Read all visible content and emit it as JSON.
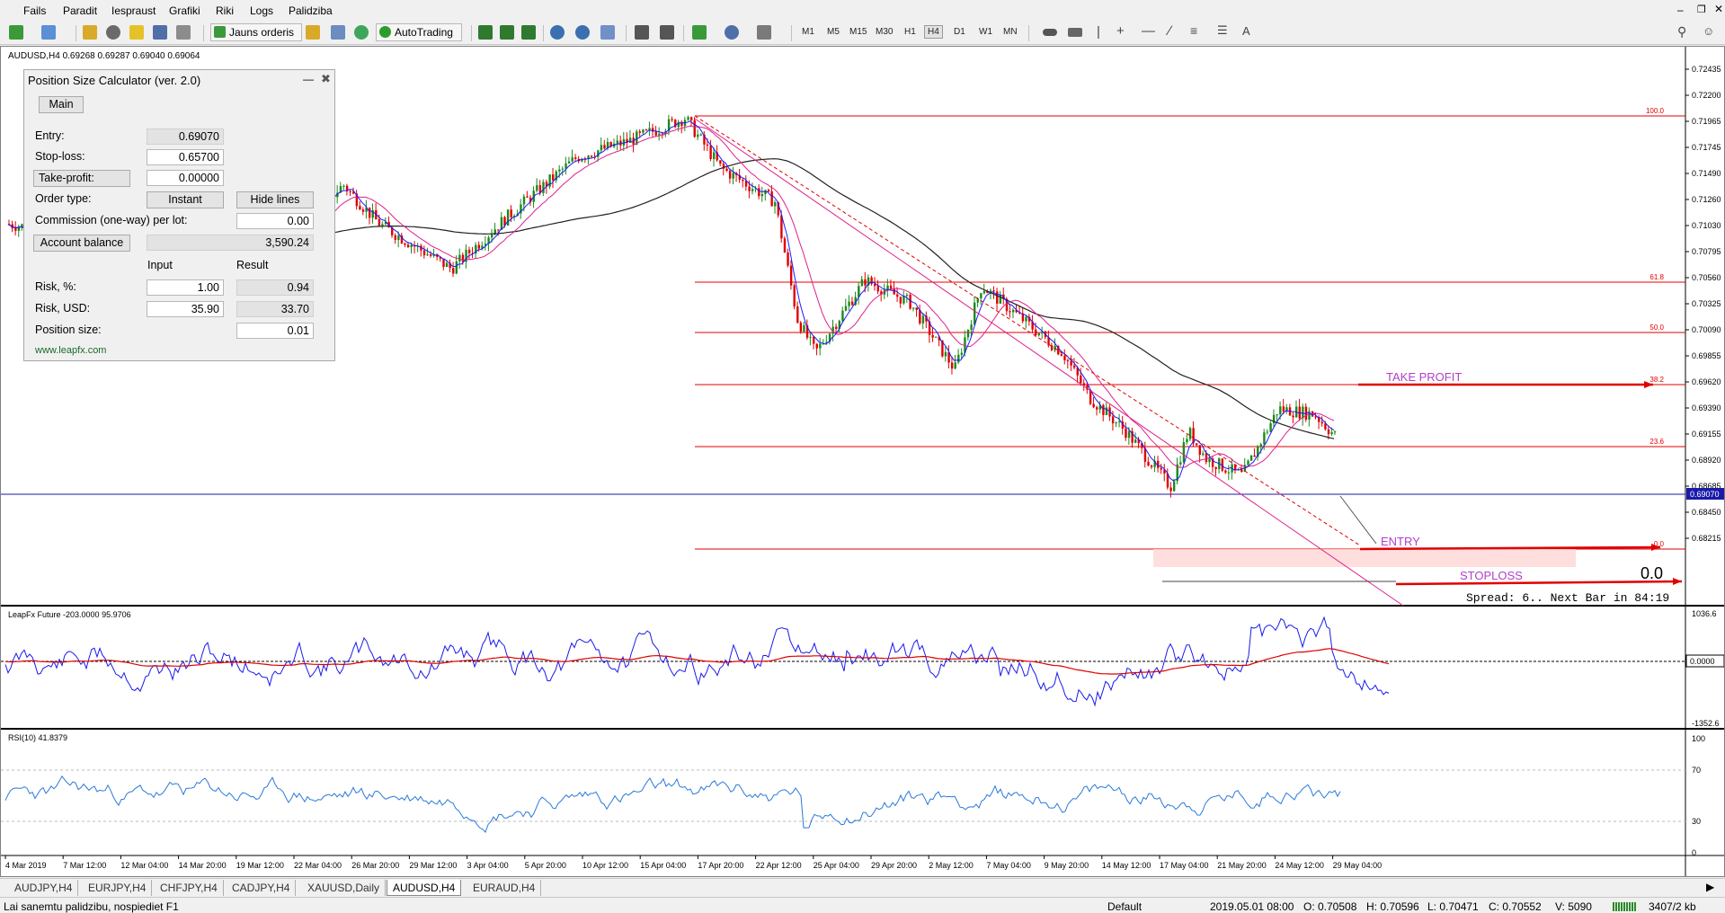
{
  "menu": [
    "Fails",
    "Paradit",
    "Iespraust",
    "Grafiki",
    "Riki",
    "Logs",
    "Palidziba"
  ],
  "toolbar": {
    "new_order_label": "Jauns orderis",
    "autotrading_label": "AutoTrading",
    "timeframes": [
      "M1",
      "M5",
      "M15",
      "M30",
      "H1",
      "H4",
      "D1",
      "W1",
      "MN"
    ],
    "active_timeframe": "H4",
    "text_tool": "A"
  },
  "chart": {
    "header": "AUDUSD,H4  0.69268 0.69287 0.69040 0.69064",
    "price_labels": [
      "0.72435",
      "0.72200",
      "0.71965",
      "0.71745",
      "0.71490",
      "0.71260",
      "0.71030",
      "0.70795",
      "0.70560",
      "0.70325",
      "0.70090",
      "0.69855",
      "0.69620",
      "0.69390",
      "0.69155",
      "0.68920",
      "0.68685",
      "0.68450",
      "0.68215"
    ],
    "current_price": "0.69070",
    "fib_levels": [
      "100.0",
      "61.8",
      "50.0",
      "38.2",
      "23.6",
      "0.0"
    ],
    "take_profit_label": "TAKE PROFIT",
    "entry_label": "ENTRY",
    "stoploss_label": "STOPLOSS",
    "big_value": "0.0",
    "spread_text": "Spread: 6.. Next Bar in 84:19",
    "time_labels": [
      "4 Mar 2019",
      "7 Mar 12:00",
      "12 Mar 04:00",
      "14 Mar 20:00",
      "19 Mar 12:00",
      "22 Mar 04:00",
      "26 Mar 20:00",
      "29 Mar 12:00",
      "3 Apr 04:00",
      "5 Apr 20:00",
      "10 Apr 12:00",
      "15 Apr 04:00",
      "17 Apr 20:00",
      "22 Apr 12:00",
      "25 Apr 04:00",
      "29 Apr 20:00",
      "2 May 12:00",
      "7 May 04:00",
      "9 May 20:00",
      "14 May 12:00",
      "17 May 04:00",
      "21 May 20:00",
      "24 May 12:00",
      "29 May 04:00"
    ],
    "indicator1": {
      "label": "LeapFx Future -203.0000 95.9706",
      "top": "1036.6",
      "zero": "0.0000",
      "bottom": "-1352.6"
    },
    "indicator2": {
      "label": "RSI(10) 41.8379",
      "levels": [
        "100",
        "70",
        "30",
        "0"
      ]
    }
  },
  "psc": {
    "title": "Position Size Calculator (ver. 2.0)",
    "tab": "Main",
    "entry_label": "Entry:",
    "entry_value": "0.69070",
    "stoploss_label": "Stop-loss:",
    "stoploss_value": "0.65700",
    "takeprofit_label": "Take-profit:",
    "takeprofit_value": "0.00000",
    "ordertype_label": "Order type:",
    "ordertype_value": "Instant",
    "hidelines_label": "Hide lines",
    "commission_label": "Commission (one-way) per lot:",
    "commission_value": "0.00",
    "balance_label": "Account balance",
    "balance_value": "3,590.24",
    "input_header": "Input",
    "result_header": "Result",
    "risk_pct_label": "Risk, %:",
    "risk_pct_input": "1.00",
    "risk_pct_result": "0.94",
    "risk_usd_label": "Risk, USD:",
    "risk_usd_input": "35.90",
    "risk_usd_result": "33.70",
    "possize_label": "Position size:",
    "possize_value": "0.01",
    "link": "www.leapfx.com"
  },
  "tabs": [
    "AUDJPY,H4",
    "EURJPY,H4",
    "CHFJPY,H4",
    "CADJPY,H4",
    "XAUUSD,Daily",
    "AUDUSD,H4",
    "EURAUD,H4"
  ],
  "active_tab": "AUDUSD,H4",
  "status": {
    "help": "Lai sanemtu palidzibu, nospiediet F1",
    "profile": "Default",
    "datetime": "2019.05.01 08:00",
    "open": "O: 0.70508",
    "high": "H: 0.70596",
    "low": "L: 0.70471",
    "close": "C: 0.70552",
    "volume": "V: 5090",
    "traffic": "3407/2 kb"
  },
  "colors": {
    "bull": "#1a8a1a",
    "bear": "#e00000",
    "fib": "#e00000",
    "ma_black": "#222222",
    "ma_pink": "#e0208a",
    "ma_blue": "#1a1aff"
  }
}
